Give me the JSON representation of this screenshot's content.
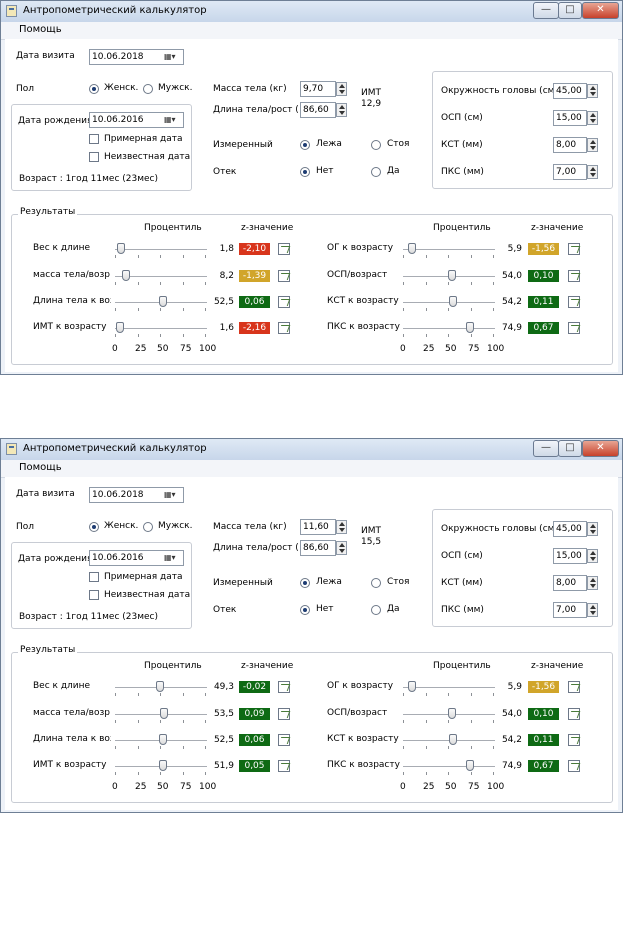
{
  "window": {
    "title": "Антропометрический калькулятор",
    "menu": "Помощь",
    "close_glyph": "✕",
    "min_glyph": "—",
    "max_glyph": "□"
  },
  "labels": {
    "visit_date": "Дата визита",
    "sex": "Пол",
    "female": "Женск.",
    "male": "Мужск.",
    "birth_date": "Дата рождения",
    "approx_date": "Примерная дата",
    "unknown_date": "Неизвестная дата",
    "mass": "Масса тела (кг)",
    "length": "Длина тела/рост (см)",
    "bmi": "ИМТ",
    "measured": "Измеренный",
    "lying": "Лежа",
    "standing": "Стоя",
    "edema": "Отек",
    "no": "Нет",
    "yes": "Да",
    "head_circ": "Окружность головы (см)",
    "osp": "ОСП (см)",
    "kst": "КСТ (мм)",
    "pks": "ПКС (мм)",
    "results": "Результаты",
    "percentile": "Процентиль",
    "zscore": "z-значение",
    "scale": [
      "0",
      "25",
      "50",
      "75",
      "100"
    ]
  },
  "colors": {
    "red": "#d8351c",
    "yellow": "#d1a52a",
    "green": "#0e6a14"
  },
  "windows": [
    {
      "visit_date": "10.06.2018",
      "birth_date": "10.06.2016",
      "age": "Возраст : 1год 11мес (23мес)",
      "mass": "9,70",
      "length": "86,60",
      "bmi": "12,9",
      "head_circ": "45,00",
      "osp": "15,00",
      "kst": "8,00",
      "pks": "7,00",
      "left": [
        {
          "label": "Вес к длине",
          "value": "1,8",
          "z": "-2,10",
          "zcolor": "red",
          "pct": 1.8
        },
        {
          "label": "масса тела/возр",
          "value": "8,2",
          "z": "-1,39",
          "zcolor": "yellow",
          "pct": 8.2
        },
        {
          "label": "Длина тела к воз",
          "value": "52,5",
          "z": "0,06",
          "zcolor": "green",
          "pct": 52.5
        },
        {
          "label": "ИМТ к возрасту",
          "value": "1,6",
          "z": "-2,16",
          "zcolor": "red",
          "pct": 1.6
        }
      ],
      "right": [
        {
          "label": "ОГ к возрасту",
          "value": "5,9",
          "z": "-1,56",
          "zcolor": "yellow",
          "pct": 5.9
        },
        {
          "label": "ОСП/возраст",
          "value": "54,0",
          "z": "0,10",
          "zcolor": "green",
          "pct": 54.0
        },
        {
          "label": "КСТ к возрасту",
          "value": "54,2",
          "z": "0,11",
          "zcolor": "green",
          "pct": 54.2
        },
        {
          "label": "ПКС к возрасту",
          "value": "74,9",
          "z": "0,67",
          "zcolor": "green",
          "pct": 74.9
        }
      ]
    },
    {
      "visit_date": "10.06.2018",
      "birth_date": "10.06.2016",
      "age": "Возраст : 1год 11мес (23мес)",
      "mass": "11,60",
      "length": "86,60",
      "bmi": "15,5",
      "head_circ": "45,00",
      "osp": "15,00",
      "kst": "8,00",
      "pks": "7,00",
      "left": [
        {
          "label": "Вес к длине",
          "value": "49,3",
          "z": "-0,02",
          "zcolor": "green",
          "pct": 49.3
        },
        {
          "label": "масса тела/возр",
          "value": "53,5",
          "z": "0,09",
          "zcolor": "green",
          "pct": 53.5
        },
        {
          "label": "Длина тела к воз",
          "value": "52,5",
          "z": "0,06",
          "zcolor": "green",
          "pct": 52.5
        },
        {
          "label": "ИМТ к возрасту",
          "value": "51,9",
          "z": "0,05",
          "zcolor": "green",
          "pct": 51.9
        }
      ],
      "right": [
        {
          "label": "ОГ к возрасту",
          "value": "5,9",
          "z": "-1,56",
          "zcolor": "yellow",
          "pct": 5.9
        },
        {
          "label": "ОСП/возраст",
          "value": "54,0",
          "z": "0,10",
          "zcolor": "green",
          "pct": 54.0
        },
        {
          "label": "КСТ к возрасту",
          "value": "54,2",
          "z": "0,11",
          "zcolor": "green",
          "pct": 54.2
        },
        {
          "label": "ПКС к возрасту",
          "value": "74,9",
          "z": "0,67",
          "zcolor": "green",
          "pct": 74.9
        }
      ]
    }
  ]
}
